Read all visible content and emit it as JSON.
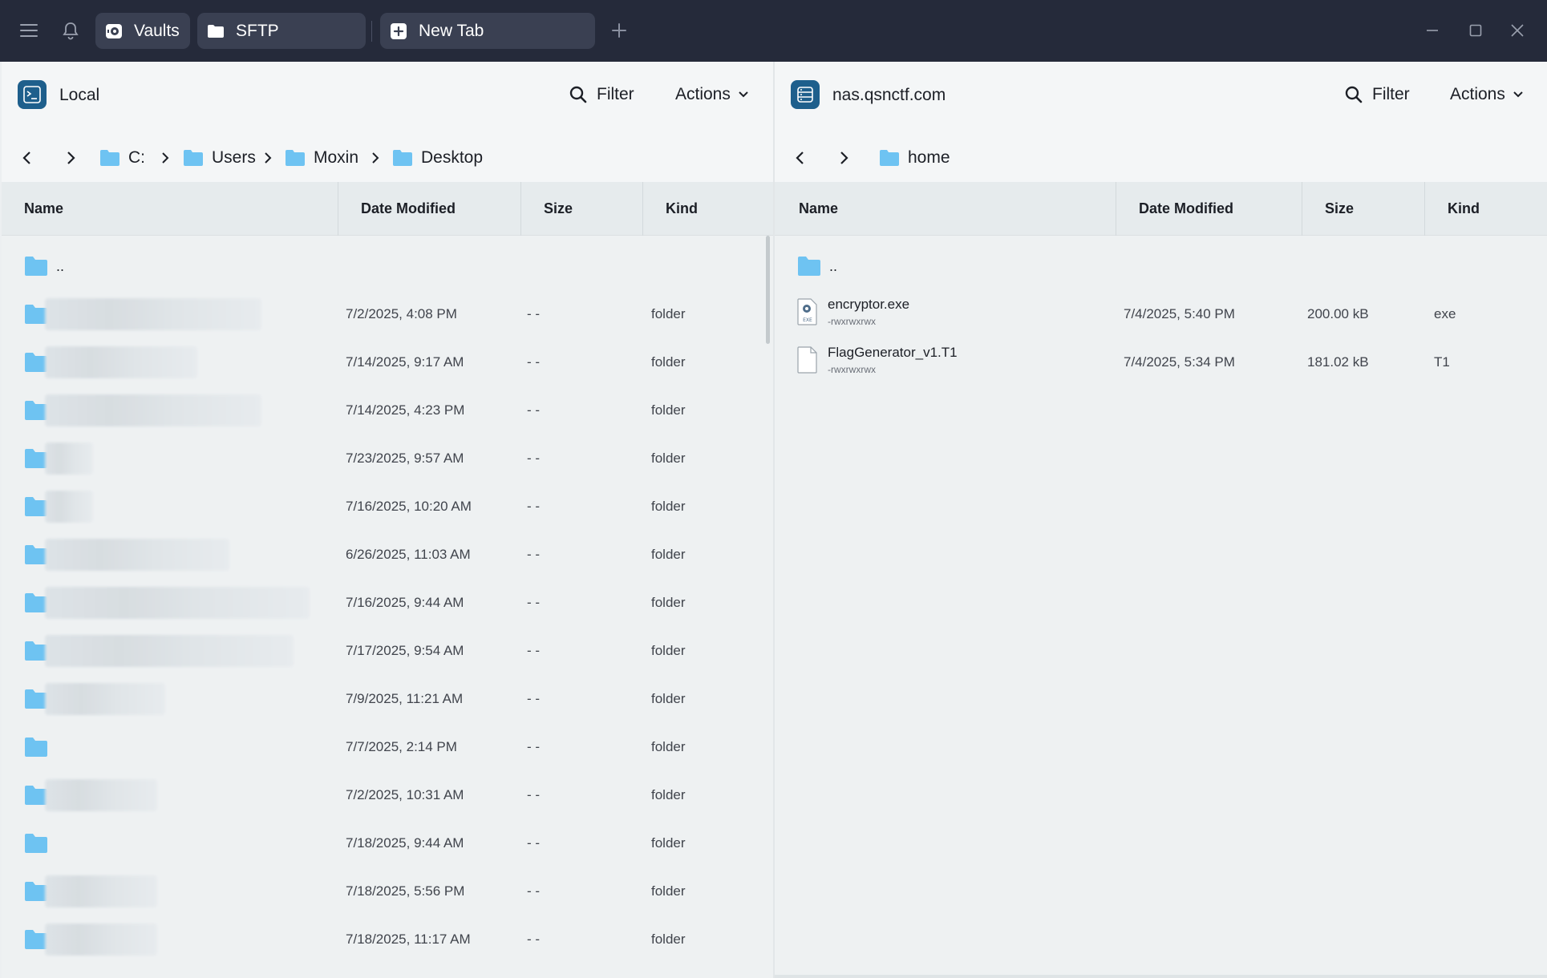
{
  "titlebar": {
    "tabs": [
      {
        "label": "Vaults",
        "icon": "vault-icon"
      },
      {
        "label": "SFTP",
        "icon": "folder-icon"
      },
      {
        "label": "New Tab",
        "icon": "plus-square-icon"
      }
    ],
    "icons": [
      "menu-icon",
      "bell-icon",
      "add-tab-icon",
      "minimize-icon",
      "maximize-icon",
      "close-icon"
    ]
  },
  "left_pane": {
    "host": "Local",
    "filter_label": "Filter",
    "actions_label": "Actions",
    "breadcrumb": [
      "C:",
      "Users",
      "Moxin",
      "Desktop"
    ],
    "columns": [
      "Name",
      "Date Modified",
      "Size",
      "Kind"
    ],
    "parent_label": "..",
    "rows": [
      {
        "date": "7/2/2025, 4:08 PM",
        "size": "- -",
        "kind": "folder"
      },
      {
        "date": "7/14/2025, 9:17 AM",
        "size": "- -",
        "kind": "folder"
      },
      {
        "date": "7/14/2025, 4:23 PM",
        "size": "- -",
        "kind": "folder"
      },
      {
        "date": "7/23/2025, 9:57 AM",
        "size": "- -",
        "kind": "folder"
      },
      {
        "date": "7/16/2025, 10:20 AM",
        "size": "- -",
        "kind": "folder"
      },
      {
        "date": "6/26/2025, 11:03 AM",
        "size": "- -",
        "kind": "folder"
      },
      {
        "date": "7/16/2025, 9:44 AM",
        "size": "- -",
        "kind": "folder"
      },
      {
        "date": "7/17/2025, 9:54 AM",
        "size": "- -",
        "kind": "folder"
      },
      {
        "date": "7/9/2025, 11:21 AM",
        "size": "- -",
        "kind": "folder"
      },
      {
        "date": "7/7/2025, 2:14 PM",
        "size": "- -",
        "kind": "folder"
      },
      {
        "date": "7/2/2025, 10:31 AM",
        "size": "- -",
        "kind": "folder"
      },
      {
        "date": "7/18/2025, 9:44 AM",
        "size": "- -",
        "kind": "folder"
      },
      {
        "date": "7/18/2025, 5:56 PM",
        "size": "- -",
        "kind": "folder"
      },
      {
        "date": "7/18/2025, 11:17 AM",
        "size": "- -",
        "kind": "folder"
      }
    ]
  },
  "right_pane": {
    "host": "nas.qsnctf.com",
    "filter_label": "Filter",
    "actions_label": "Actions",
    "breadcrumb": [
      "home"
    ],
    "columns": [
      "Name",
      "Date Modified",
      "Size",
      "Kind"
    ],
    "parent_label": "..",
    "files": [
      {
        "name": "encryptor.exe",
        "perm": "-rwxrwxrwx",
        "date": "7/4/2025, 5:40 PM",
        "size": "200.00 kB",
        "kind": "exe",
        "icon": "exe-file-icon"
      },
      {
        "name": "FlagGenerator_v1.T1",
        "perm": "-rwxrwxrwx",
        "date": "7/4/2025, 5:34 PM",
        "size": "181.02 kB",
        "kind": "T1",
        "icon": "file-icon"
      }
    ]
  },
  "colors": {
    "titlebar": "#252a3a",
    "tab_bg": "#3a4052",
    "folder": "#6ec3f2",
    "host_badge": "#1e5f8c"
  }
}
